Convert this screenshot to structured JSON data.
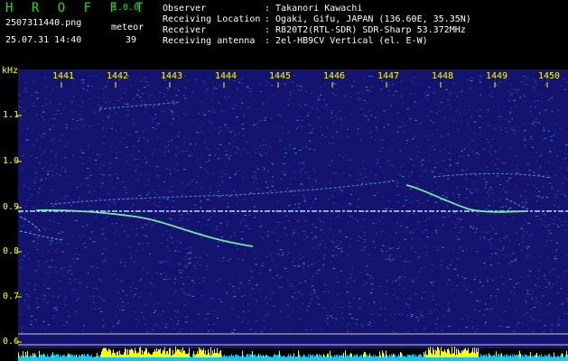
{
  "header": {
    "app_name": "H R O F F T",
    "version": "1.0.0",
    "file_name": "2507311440.png",
    "meteor_label": "meteor",
    "datetime": "25.07.31 14:40",
    "meteor_count": "39"
  },
  "info": [
    {
      "label": "Observer",
      "value": ": Takanori Kawachi"
    },
    {
      "label": "Receiving Location",
      "value": ": Ogaki, Gifu, JAPAN (136.60E, 35.35N)"
    },
    {
      "label": "Receiver",
      "value": ": R820T2(RTL-SDR) SDR-Sharp 53.372MHz"
    },
    {
      "label": "Receiving antenna",
      "value": ": 2el-HB9CV Vertical (el. E-W)"
    }
  ],
  "plot": {
    "y_unit": "kHz",
    "x_ticks": [
      "1441",
      "1442",
      "1443",
      "1444",
      "1445",
      "1446",
      "1447",
      "1448",
      "1449",
      "1450"
    ],
    "y_ticks": [
      "1.1",
      "1.0",
      "0.9",
      "0.8",
      "0.7",
      "0.6"
    ],
    "colors": {
      "background": "#14146e",
      "tick_text": "#ffff00",
      "carrier": "#b4dcff",
      "meteor_trail": "#78e6a0",
      "bottom_bar_cyan": "#00ccff",
      "bottom_bar_yellow": "#ffff00"
    }
  }
}
